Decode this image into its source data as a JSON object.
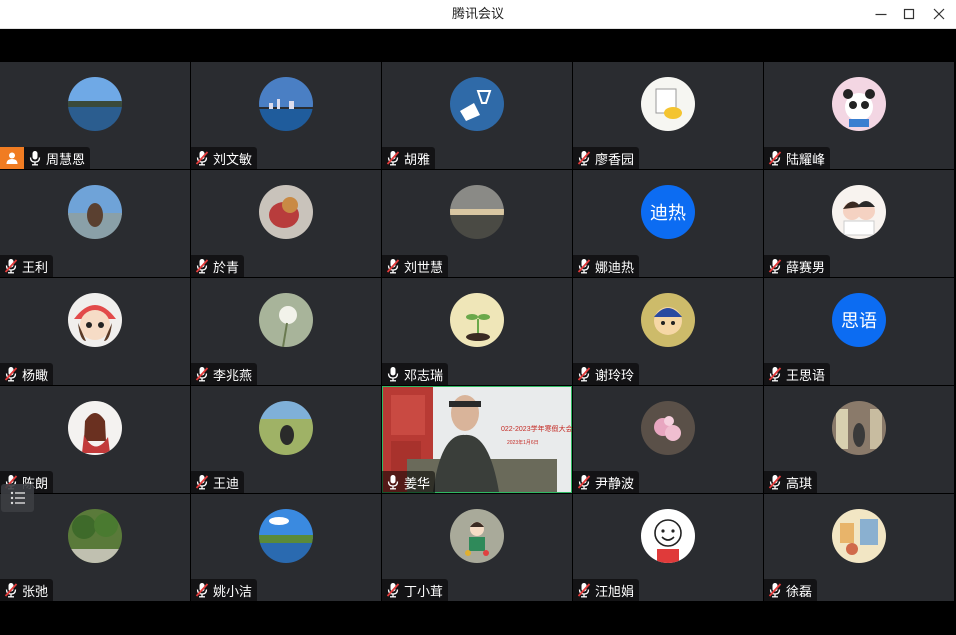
{
  "window": {
    "title": "腾讯会议"
  },
  "participants": [
    {
      "name": "周慧恩",
      "mic": "on",
      "host": true,
      "avatar": "lake-landscape-photo"
    },
    {
      "name": "刘文敏",
      "mic": "muted",
      "avatar": "city-skyline-photo"
    },
    {
      "name": "胡雅",
      "mic": "muted",
      "avatar": "cheers-illustration"
    },
    {
      "name": "廖香园",
      "mic": "muted",
      "avatar": "yellow-cartoon-sticker"
    },
    {
      "name": "陆耀峰",
      "mic": "muted",
      "avatar": "panda-cartoon"
    },
    {
      "name": "王利",
      "mic": "muted",
      "avatar": "person-outdoors-photo"
    },
    {
      "name": "於青",
      "mic": "muted",
      "avatar": "dog-photo"
    },
    {
      "name": "刘世慧",
      "mic": "muted",
      "avatar": "sunset-beach-photo"
    },
    {
      "name": "娜迪热",
      "mic": "muted",
      "avatar": "text-avatar",
      "avatar_text": "迪热"
    },
    {
      "name": "薛赛男",
      "mic": "muted",
      "avatar": "couple-cartoon"
    },
    {
      "name": "杨瞰",
      "mic": "muted",
      "avatar": "girl-cartoon-red-hat"
    },
    {
      "name": "李兆燕",
      "mic": "muted",
      "avatar": "white-flower-photo"
    },
    {
      "name": "邓志瑞",
      "mic": "on",
      "avatar": "sprout-photo"
    },
    {
      "name": "谢玲玲",
      "mic": "muted",
      "avatar": "cartoon-kid-yellow"
    },
    {
      "name": "王思语",
      "mic": "muted",
      "avatar": "text-avatar",
      "avatar_text": "思语"
    },
    {
      "name": "陈朗",
      "mic": "muted",
      "avatar": "girl-illustration"
    },
    {
      "name": "王迪",
      "mic": "muted",
      "avatar": "person-on-grass-photo"
    },
    {
      "name": "姜华",
      "mic": "on",
      "video": true,
      "video_text": "022-2023学年寒假大会",
      "video_subtext": "2023年1月6日"
    },
    {
      "name": "尹静波",
      "mic": "muted",
      "avatar": "pink-flowers-photo"
    },
    {
      "name": "高琪",
      "mic": "muted",
      "avatar": "shop-interior-photo"
    },
    {
      "name": "张弛",
      "mic": "muted",
      "avatar": "park-trees-photo"
    },
    {
      "name": "姚小洁",
      "mic": "muted",
      "avatar": "lake-blue-sky-photo"
    },
    {
      "name": "丁小茸",
      "mic": "muted",
      "avatar": "girl-cartoon-gray"
    },
    {
      "name": "汪旭娟",
      "mic": "muted",
      "avatar": "smiling-face-cartoon"
    },
    {
      "name": "徐磊",
      "mic": "muted",
      "avatar": "illustration-scene"
    }
  ],
  "colors": {
    "host_badge": "#f07c22",
    "muted_slash": "#e23b3b",
    "text_avatar_bg": "#0c6cf2",
    "active_speaker_border": "#2fb863",
    "tile_bg": "#2a2c30"
  },
  "icons": {
    "member_list": "list-icon",
    "host": "person-icon",
    "mic_on": "microphone-icon",
    "mic_muted": "microphone-muted-icon"
  }
}
